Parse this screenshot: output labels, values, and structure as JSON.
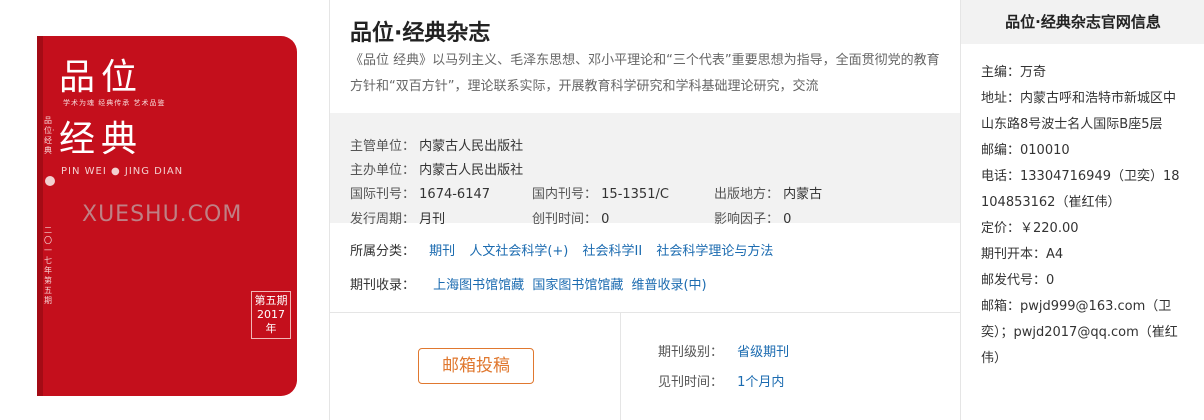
{
  "cover": {
    "title_line1": "品位",
    "title_line2": "经典",
    "tags": "学术为魂 经典传承 艺术品鉴",
    "pinyin": "PIN WEI ● JING DIAN",
    "side_text": "品位·经典",
    "side_text2": "二〇一七年第五期",
    "issue": "第五期 2017年",
    "watermark": "XUESHU.COM"
  },
  "journal": {
    "title": "品位·经典杂志",
    "description": "《品位 经典》以马列主义、毛泽东思想、邓小平理论和“三个代表”重要思想为指导，全面贯彻党的教育方针和“双百方针”，理论联系实际，开展教育科学研究和学科基础理论研究，交流"
  },
  "meta": {
    "supervisor_label": "主管单位：",
    "supervisor_value": "内蒙古人民出版社",
    "sponsor_label": "主办单位：",
    "sponsor_value": "内蒙古人民出版社",
    "issn_label": "国际刊号：",
    "issn_value": "1674-6147",
    "cn_label": "国内刊号：",
    "cn_value": "15-1351/C",
    "place_label": "出版地方：",
    "place_value": "内蒙古",
    "cycle_label": "发行周期：",
    "cycle_value": "月刊",
    "founded_label": "创刊时间：",
    "founded_value": "0",
    "impact_label": "影响因子：",
    "impact_value": "0"
  },
  "category": {
    "label": "所属分类：",
    "items": [
      "期刊",
      "人文社会科学(+)",
      "社会科学II",
      "社会科学理论与方法"
    ]
  },
  "collect": {
    "label": "期刊收录：",
    "items": [
      "上海图书馆馆藏",
      "国家图书馆馆藏",
      "维普收录(中)"
    ]
  },
  "bottom": {
    "submit_label": "邮箱投稿",
    "level_label": "期刊级别：",
    "level_value": "省级期刊",
    "period_label": "见刊时间：",
    "period_value": "1个月内"
  },
  "official": {
    "title": "品位·经典杂志官网信息",
    "lines": [
      "主编：万奇",
      "地址：内蒙古呼和浩特市新城区中山东路8号波士名人国际B座5层",
      "邮编：010010",
      "电话：13304716949（卫奕）18104853162（崔红伟）",
      "定价：￥220.00",
      "期刊开本：A4",
      "邮发代号：0",
      "邮箱：pwjd999@163.com（卫奕）；pwjd2017@qq.com（崔红伟）"
    ]
  },
  "colors": {
    "cover_red": "#c40f1c",
    "link_blue": "#1b6bb0",
    "button_orange": "#e0782f",
    "panel_gray": "#f2f2f2"
  }
}
